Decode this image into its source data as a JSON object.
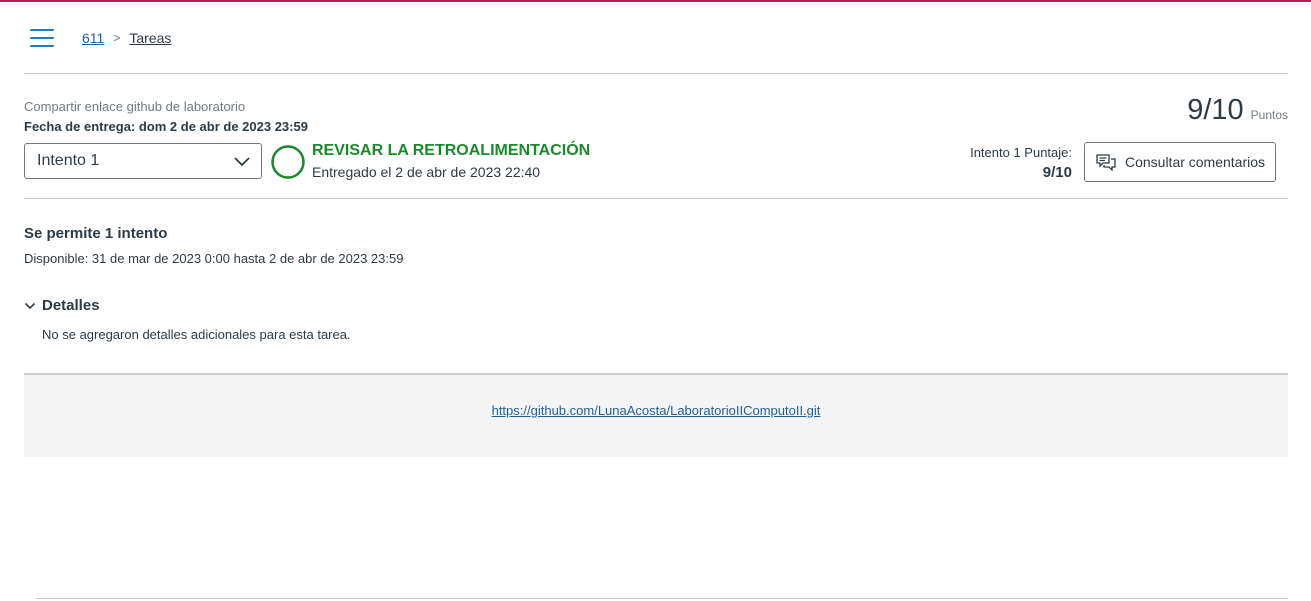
{
  "breadcrumb": {
    "course": "611",
    "section": "Tareas"
  },
  "assignment": {
    "name": "Compartir enlace github de laboratorio",
    "due_label": "Fecha de entrega: dom 2 de abr de 2023 23:59"
  },
  "points": {
    "value": "9/10",
    "label": "Puntos"
  },
  "attempt_select": {
    "selected": "Intento 1"
  },
  "status": {
    "title": "REVISAR LA RETROALIMENTACIÓN",
    "submitted": "Entregado el 2 de abr de 2023 22:40",
    "color": "#1a8a2d"
  },
  "score": {
    "label": "Intento 1 Puntaje:",
    "value": "9/10"
  },
  "feedback_button": {
    "label": "Consultar comentarios",
    "icon": "comments-icon"
  },
  "attempts": {
    "allowed": "Se permite 1 intento",
    "available": "Disponible: 31 de mar de 2023 0:00 hasta 2 de abr de 2023 23:59"
  },
  "details": {
    "heading": "Detalles",
    "text": "No se agregaron detalles adicionales para esta tarea."
  },
  "submission": {
    "url": "https://github.com/LunaAcosta/LaboratorioIIComputoII.git"
  },
  "colors": {
    "accent": "#b5174f",
    "link": "#1f5f99",
    "success": "#1a8a2d"
  }
}
